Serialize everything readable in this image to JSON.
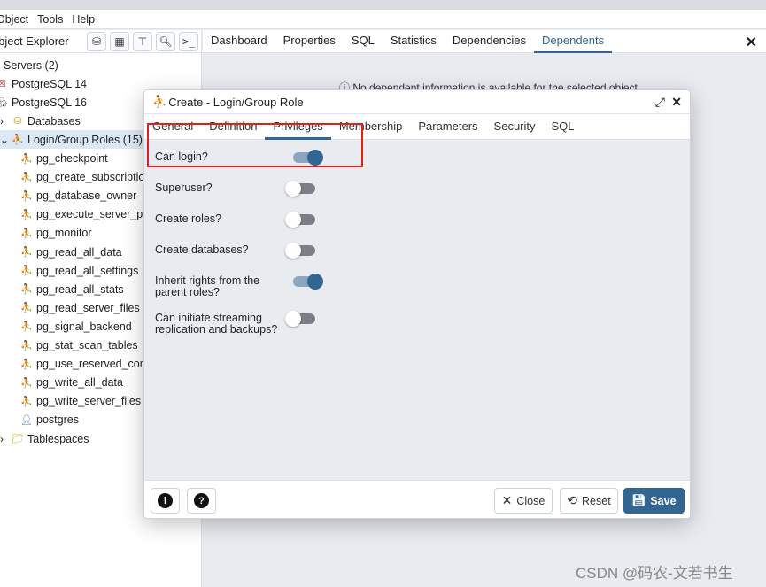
{
  "menu": [
    "Object",
    "Tools",
    "Help"
  ],
  "explorer": {
    "title": "Object Explorer",
    "tools": [
      "query-tool-icon",
      "table-icon",
      "filter-table-icon",
      "search-icon",
      "terminal-icon"
    ]
  },
  "tree": [
    {
      "label": "Servers (2)",
      "level": 0,
      "icon": "servers-icon"
    },
    {
      "label": "PostgreSQL 14",
      "level": 0,
      "icon": "server-disconnected-icon"
    },
    {
      "label": "PostgreSQL 16",
      "level": 0,
      "icon": "elephant-icon"
    },
    {
      "label": "Databases",
      "level": 1,
      "icon": "databases-icon"
    },
    {
      "label": "Login/Group Roles (15)",
      "level": 1,
      "icon": "roles-icon",
      "selected": true
    },
    {
      "label": "pg_checkpoint",
      "level": 2,
      "icon": "group-role-icon"
    },
    {
      "label": "pg_create_subscription",
      "level": 2,
      "icon": "group-role-icon"
    },
    {
      "label": "pg_database_owner",
      "level": 2,
      "icon": "group-role-icon"
    },
    {
      "label": "pg_execute_server_program",
      "level": 2,
      "icon": "group-role-icon"
    },
    {
      "label": "pg_monitor",
      "level": 2,
      "icon": "group-role-icon"
    },
    {
      "label": "pg_read_all_data",
      "level": 2,
      "icon": "group-role-icon"
    },
    {
      "label": "pg_read_all_settings",
      "level": 2,
      "icon": "group-role-icon"
    },
    {
      "label": "pg_read_all_stats",
      "level": 2,
      "icon": "group-role-icon"
    },
    {
      "label": "pg_read_server_files",
      "level": 2,
      "icon": "group-role-icon"
    },
    {
      "label": "pg_signal_backend",
      "level": 2,
      "icon": "group-role-icon"
    },
    {
      "label": "pg_stat_scan_tables",
      "level": 2,
      "icon": "group-role-icon"
    },
    {
      "label": "pg_use_reserved_connections",
      "level": 2,
      "icon": "group-role-icon"
    },
    {
      "label": "pg_write_all_data",
      "level": 2,
      "icon": "group-role-icon"
    },
    {
      "label": "pg_write_server_files",
      "level": 2,
      "icon": "group-role-icon"
    },
    {
      "label": "postgres",
      "level": 2,
      "icon": "login-role-icon"
    },
    {
      "label": "Tablespaces",
      "level": 1,
      "icon": "folder-icon"
    }
  ],
  "main_tabs": [
    "Dashboard",
    "Properties",
    "SQL",
    "Statistics",
    "Dependencies",
    "Dependents"
  ],
  "main_active_tab": "Dependents",
  "main_message": "No dependent information is available for the selected object.",
  "dialog": {
    "title": "Create - Login/Group Role",
    "tabs": [
      "General",
      "Definition",
      "Privileges",
      "Membership",
      "Parameters",
      "Security",
      "SQL"
    ],
    "active_tab": "Privileges",
    "privileges": [
      {
        "label": "Can login?",
        "value": true
      },
      {
        "label": "Superuser?",
        "value": false
      },
      {
        "label": "Create roles?",
        "value": false
      },
      {
        "label": "Create databases?",
        "value": false
      },
      {
        "label": "Inherit rights from the parent roles?",
        "value": true
      },
      {
        "label": "Can initiate streaming replication and backups?",
        "value": false
      }
    ],
    "buttons": {
      "close": "Close",
      "reset": "Reset",
      "save": "Save"
    }
  },
  "accent": "#326690",
  "highlight_color": "#e0201c",
  "watermark": "CSDN @码农-文若书生"
}
